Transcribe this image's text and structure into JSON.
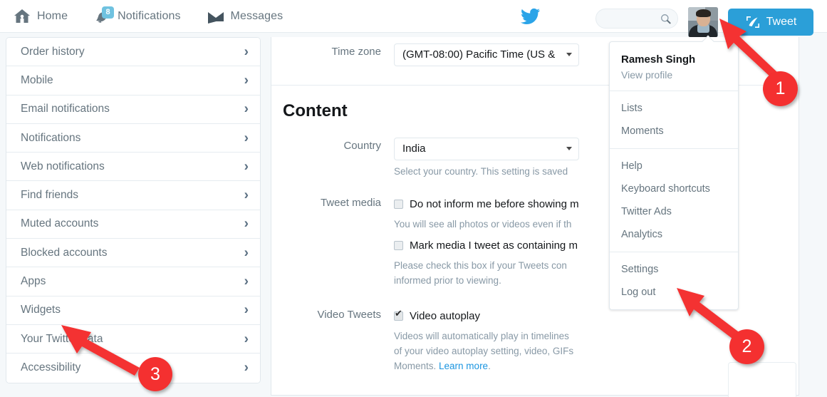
{
  "topnav": {
    "items": [
      {
        "label": "Home",
        "icon": "home-icon",
        "badge": null
      },
      {
        "label": "Notifications",
        "icon": "bell-icon",
        "badge": "8"
      },
      {
        "label": "Messages",
        "icon": "envelope-icon",
        "badge": null
      }
    ],
    "logo_icon": "twitter-bird-logo",
    "search": {
      "value": "",
      "placeholder": "",
      "icon": "search-icon"
    },
    "avatar_alt": "Ramesh Singh profile photo",
    "tweet_button": {
      "label": "Tweet",
      "icon": "feather-quill-icon"
    }
  },
  "sidebar": {
    "items": [
      {
        "label": "Order history"
      },
      {
        "label": "Mobile"
      },
      {
        "label": "Email notifications"
      },
      {
        "label": "Notifications"
      },
      {
        "label": "Web notifications"
      },
      {
        "label": "Find friends"
      },
      {
        "label": "Muted accounts"
      },
      {
        "label": "Blocked accounts"
      },
      {
        "label": "Apps"
      },
      {
        "label": "Widgets"
      },
      {
        "label": "Your Twitter data"
      },
      {
        "label": "Accessibility"
      }
    ],
    "chevron": "›"
  },
  "content": {
    "timezone": {
      "label": "Time zone",
      "value": "(GMT-08:00) Pacific Time (US &"
    },
    "section_title": "Content",
    "country": {
      "label": "Country",
      "value": "India",
      "hint": "Select your country. This setting is saved"
    },
    "tweet_media": {
      "label": "Tweet media",
      "checkbox1": {
        "text": "Do not inform me before showing m",
        "checked": false
      },
      "hint1": "You will see all photos or videos even if th",
      "checkbox2": {
        "text": "Mark media I tweet as containing m",
        "checked": false
      },
      "hint2_line1": "Please check this box if your Tweets con",
      "hint2_line2": "informed prior to viewing."
    },
    "video_tweets": {
      "label": "Video Tweets",
      "checkbox": {
        "text": "Video autoplay",
        "checked": true
      },
      "hint_line1": "Videos will automatically play in timelines",
      "hint_line2": "of your video autoplay setting, video, GIFs",
      "hint_line3_prefix": "Moments. ",
      "hint_link": "Learn more",
      "hint_line3_suffix": "."
    }
  },
  "dropdown": {
    "name": "Ramesh Singh",
    "view_profile": "View profile",
    "groups": [
      {
        "items": [
          {
            "label": "Lists"
          },
          {
            "label": "Moments"
          }
        ]
      },
      {
        "items": [
          {
            "label": "Help"
          },
          {
            "label": "Keyboard shortcuts"
          },
          {
            "label": "Twitter Ads"
          },
          {
            "label": "Analytics"
          }
        ]
      },
      {
        "items": [
          {
            "label": "Settings"
          },
          {
            "label": "Log out"
          }
        ]
      }
    ]
  },
  "annotations": [
    {
      "number": "1",
      "target": "avatar"
    },
    {
      "number": "2",
      "target": "settings-menu-item"
    },
    {
      "number": "3",
      "target": "sidebar-item-widgets"
    }
  ],
  "colors": {
    "twitter_blue": "#2b9fd8",
    "annotation_red": "#f43030",
    "badge_blue": "#6fc2e0",
    "link_blue": "#1b95e0",
    "page_bg": "#f5f8fa"
  }
}
